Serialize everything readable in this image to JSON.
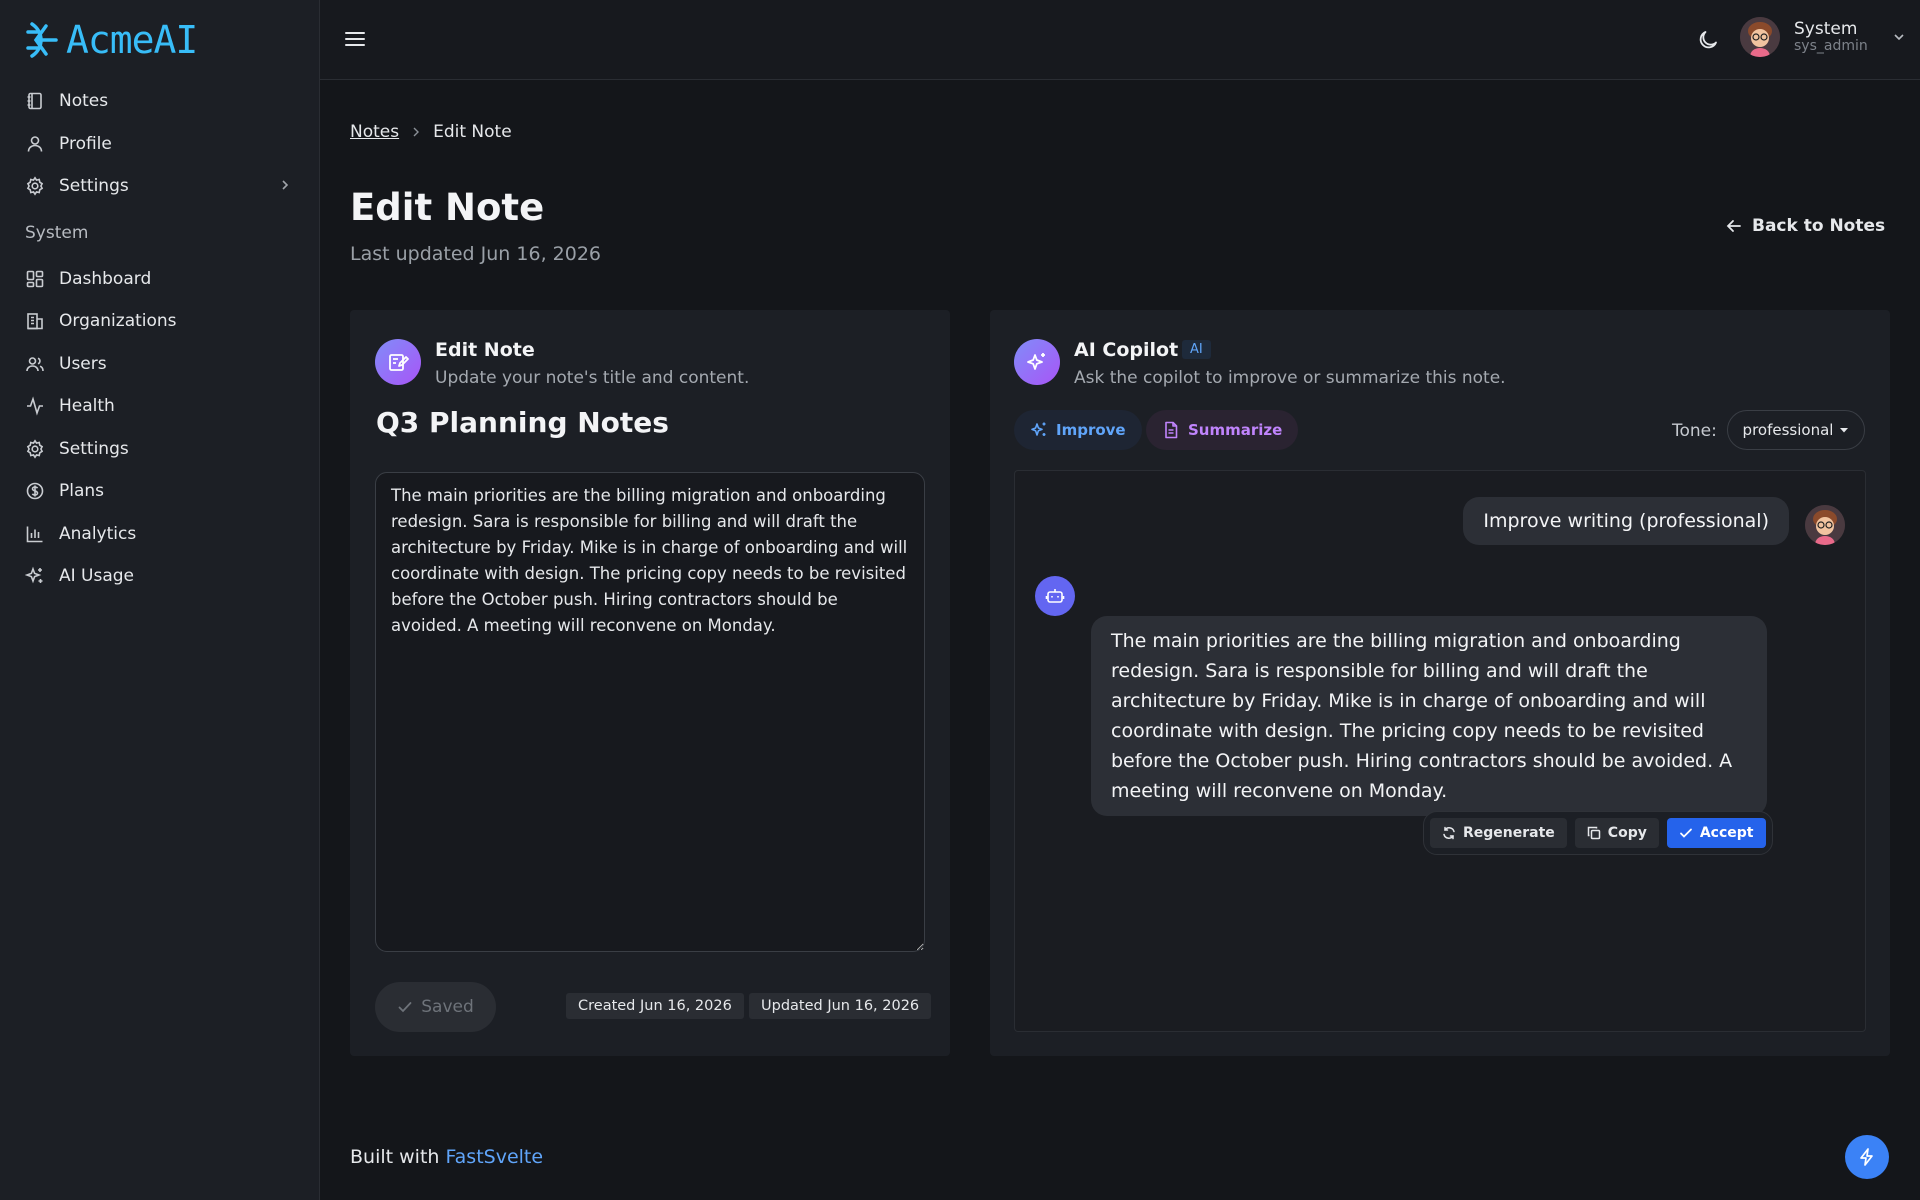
{
  "app": {
    "logo_text": "AcmeAI"
  },
  "sidebar": {
    "items": [
      {
        "label": "Notes",
        "icon": "notebook-icon"
      },
      {
        "label": "Profile",
        "icon": "user-icon"
      },
      {
        "label": "Settings",
        "icon": "gear-icon"
      }
    ],
    "section_label": "System",
    "system_items": [
      {
        "label": "Dashboard",
        "icon": "dashboard-icon"
      },
      {
        "label": "Organizations",
        "icon": "building-icon"
      },
      {
        "label": "Users",
        "icon": "users-icon"
      },
      {
        "label": "Health",
        "icon": "activity-icon"
      },
      {
        "label": "Settings",
        "icon": "gear-icon"
      },
      {
        "label": "Plans",
        "icon": "dollar-icon"
      },
      {
        "label": "Analytics",
        "icon": "bar-chart-icon"
      },
      {
        "label": "AI Usage",
        "icon": "sparkles-icon"
      }
    ]
  },
  "header": {
    "user_name": "System",
    "user_handle": "sys_admin"
  },
  "breadcrumb": {
    "parent": "Notes",
    "current": "Edit Note"
  },
  "page": {
    "title": "Edit Note",
    "subtitle": "Last updated Jun 16, 2026",
    "back_label": "Back to Notes"
  },
  "editor": {
    "title": "Edit Note",
    "subtitle": "Update your note's title and content.",
    "note_title": "Q3 Planning Notes",
    "note_content": "The main priorities are the billing migration and onboarding redesign. Sara is responsible for billing and will draft the architecture by Friday. Mike is in charge of onboarding and will coordinate with design. The pricing copy needs to be revisited before the October push. Hiring contractors should be avoided. A meeting will reconvene on Monday.",
    "saved_label": "Saved",
    "created": "Created Jun 16, 2026",
    "updated": "Updated Jun 16, 2026"
  },
  "copilot": {
    "title": "AI Copilot",
    "badge": "AI",
    "subtitle": "Ask the copilot to improve or summarize this note.",
    "improve_label": "Improve",
    "summarize_label": "Summarize",
    "tone_label": "Tone:",
    "tone_value": "professional",
    "user_message": "Improve writing (professional)",
    "bot_message": "The main priorities are the billing migration and onboarding redesign. Sara is responsible for billing and will draft the architecture by Friday. Mike is in charge of onboarding and will coordinate with design. The pricing copy needs to be revisited before the October push. Hiring contractors should be avoided. A meeting will reconvene on Monday.",
    "regenerate_label": "Regenerate",
    "copy_label": "Copy",
    "accept_label": "Accept"
  },
  "footer": {
    "prefix": "Built with",
    "link": "FastSvelte"
  },
  "colors": {
    "accent": "#3b82f6",
    "brand": "#38bdf8",
    "background": "#14161a"
  }
}
